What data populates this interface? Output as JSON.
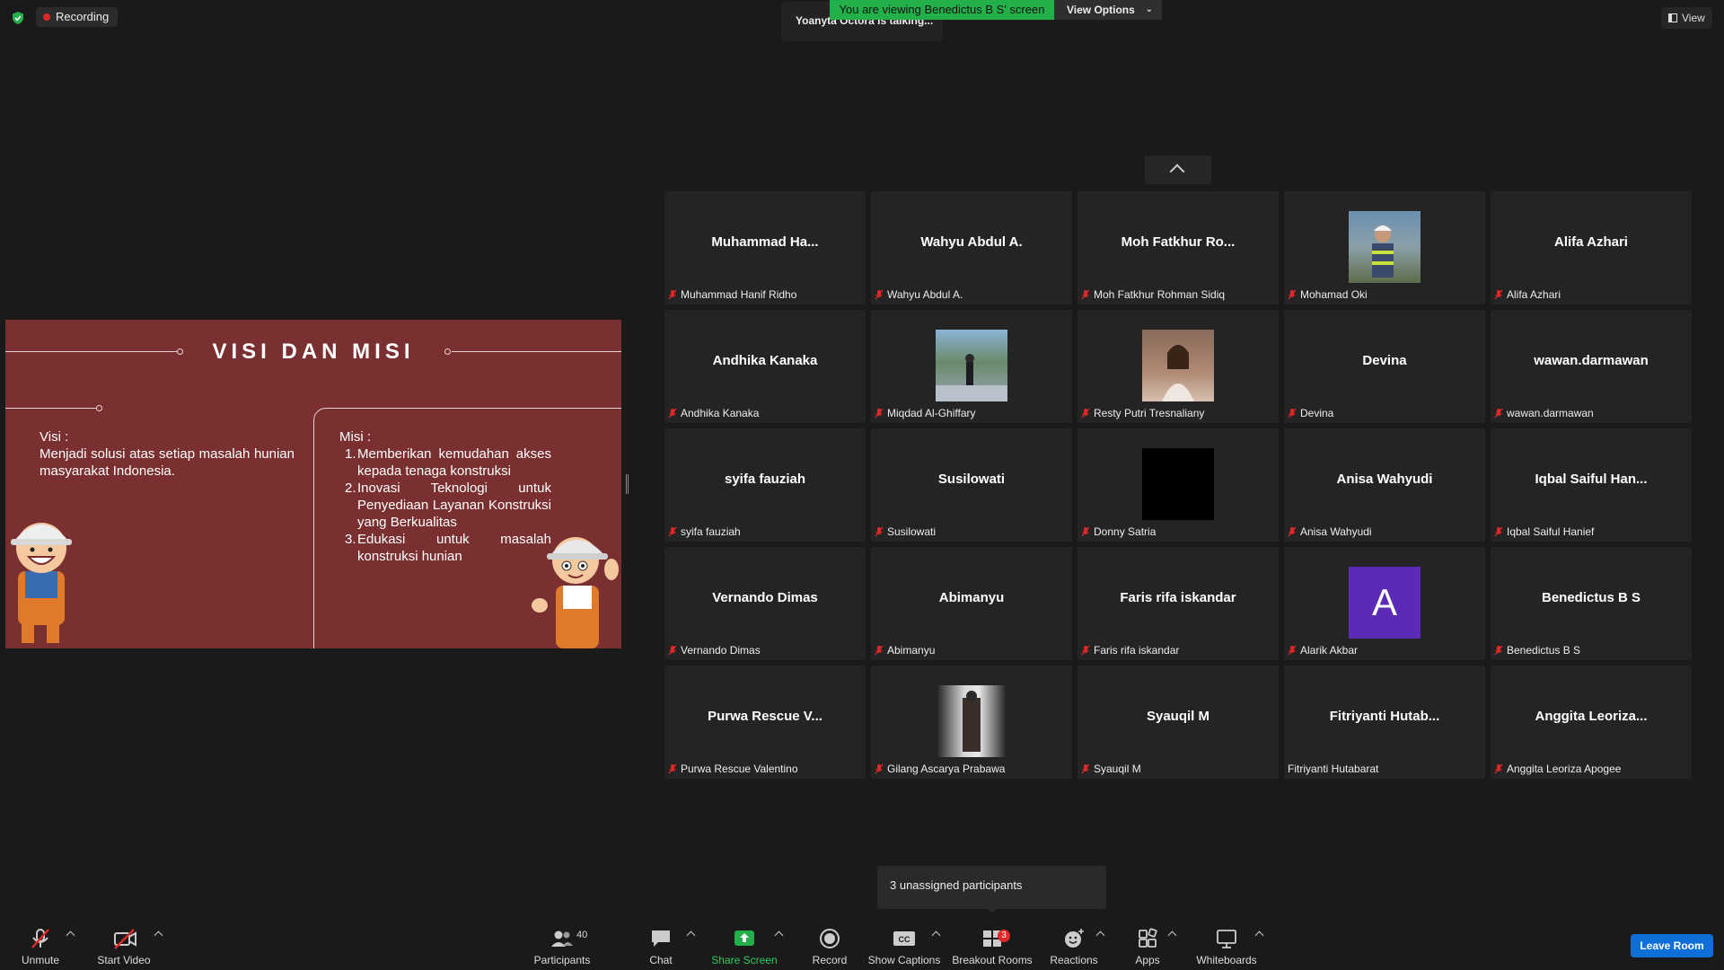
{
  "topbar": {
    "recording_label": "Recording",
    "talking_text": "Yoanyta Octora is talking...",
    "viewing_text": "You are viewing Benedictus B S' screen",
    "view_options_label": "View Options",
    "view_label": "View"
  },
  "slide": {
    "title": "VISI DAN MISI",
    "visi_label": "Visi :",
    "visi_text": "Menjadi solusi atas setiap masalah hunian masyarakat Indonesia.",
    "misi_label": "Misi :",
    "misi_items": [
      {
        "num": "1.",
        "text": "Memberikan kemudahan akses kepada tenaga konstruksi"
      },
      {
        "num": "2.",
        "text": "Inovasi Teknologi untuk Penyediaan Layanan Konstruksi yang Berkualitas"
      },
      {
        "num": "3.",
        "text": "Edukasi untuk masalah konstruksi hunian"
      }
    ]
  },
  "gallery": {
    "tiles": [
      {
        "big": "Muhammad  Ha...",
        "label": "Muhammad Hanif Ridho",
        "muted": true
      },
      {
        "big": "Wahyu Abdul A.",
        "label": "Wahyu Abdul A.",
        "muted": true
      },
      {
        "big": "Moh  Fatkhur  Ro...",
        "label": "Moh Fatkhur Rohman Sidiq",
        "muted": true
      },
      {
        "big": "",
        "label": "Mohamad Oki",
        "muted": true,
        "photo": "worker-photo"
      },
      {
        "big": "Alifa Azhari",
        "label": "Alifa Azhari",
        "muted": true
      },
      {
        "big": "Andhika Kanaka",
        "label": "Andhika Kanaka",
        "muted": true
      },
      {
        "big": "",
        "label": "Miqdad Al-Ghiffary",
        "muted": true,
        "photo": "outdoor-photo"
      },
      {
        "big": "",
        "label": "Resty Putri Tresnaliany",
        "muted": true,
        "photo": "portrait-photo"
      },
      {
        "big": "Devina",
        "label": "Devina",
        "muted": true
      },
      {
        "big": "wawan.darmawan",
        "label": "wawan.darmawan",
        "muted": true
      },
      {
        "big": "syifa fauziah",
        "label": "syifa fauziah",
        "muted": true
      },
      {
        "big": "Susilowati",
        "label": "Susilowati",
        "muted": true
      },
      {
        "big": "",
        "label": "Donny Satria",
        "muted": true,
        "photo": "black-photo"
      },
      {
        "big": "Anisa Wahyudi",
        "label": "Anisa Wahyudi",
        "muted": true
      },
      {
        "big": "Iqbal  Saiful  Han...",
        "label": "Iqbal Saiful Hanief",
        "muted": true
      },
      {
        "big": "Vernando Dimas",
        "label": "Vernando Dimas",
        "muted": true
      },
      {
        "big": "Abimanyu",
        "label": "Abimanyu",
        "muted": true
      },
      {
        "big": "Faris rifa iskandar",
        "label": "Faris rifa iskandar",
        "muted": true
      },
      {
        "big": "",
        "label": "Alarik Akbar",
        "muted": true,
        "photo": "letter-avatar",
        "avatar_letter": "A",
        "avatar_color": "#5b2bb5"
      },
      {
        "big": "Benedictus B S",
        "label": "Benedictus B S",
        "muted": true
      },
      {
        "big": "Purwa Rescue V...",
        "label": "Purwa Rescue Valentino",
        "muted": true
      },
      {
        "big": "",
        "label": "Gilang Ascarya Prabawa",
        "muted": true,
        "photo": "window-photo"
      },
      {
        "big": "Syauqil M",
        "label": "Syauqil M",
        "muted": true
      },
      {
        "big": "Fitriyanti  Hutab...",
        "label": "Fitriyanti Hutabarat",
        "muted": false
      },
      {
        "big": "Anggita  Leoriza...",
        "label": "Anggita Leoriza Apogee",
        "muted": true
      }
    ]
  },
  "tooltip": {
    "unassigned": "3 unassigned participants"
  },
  "toolbar": {
    "unmute": "Unmute",
    "start_video": "Start Video",
    "participants": "Participants",
    "participants_count": "40",
    "chat": "Chat",
    "share_screen": "Share Screen",
    "record": "Record",
    "show_captions": "Show Captions",
    "breakout_rooms": "Breakout Rooms",
    "breakout_count": "3",
    "reactions": "Reactions",
    "apps": "Apps",
    "whiteboards": "Whiteboards",
    "leave_room": "Leave Room"
  },
  "colors": {
    "share_green": "#23b04a",
    "mute_red": "#e02828",
    "leave_blue": "#0e6fd8",
    "slide_bg": "#7a3030"
  }
}
